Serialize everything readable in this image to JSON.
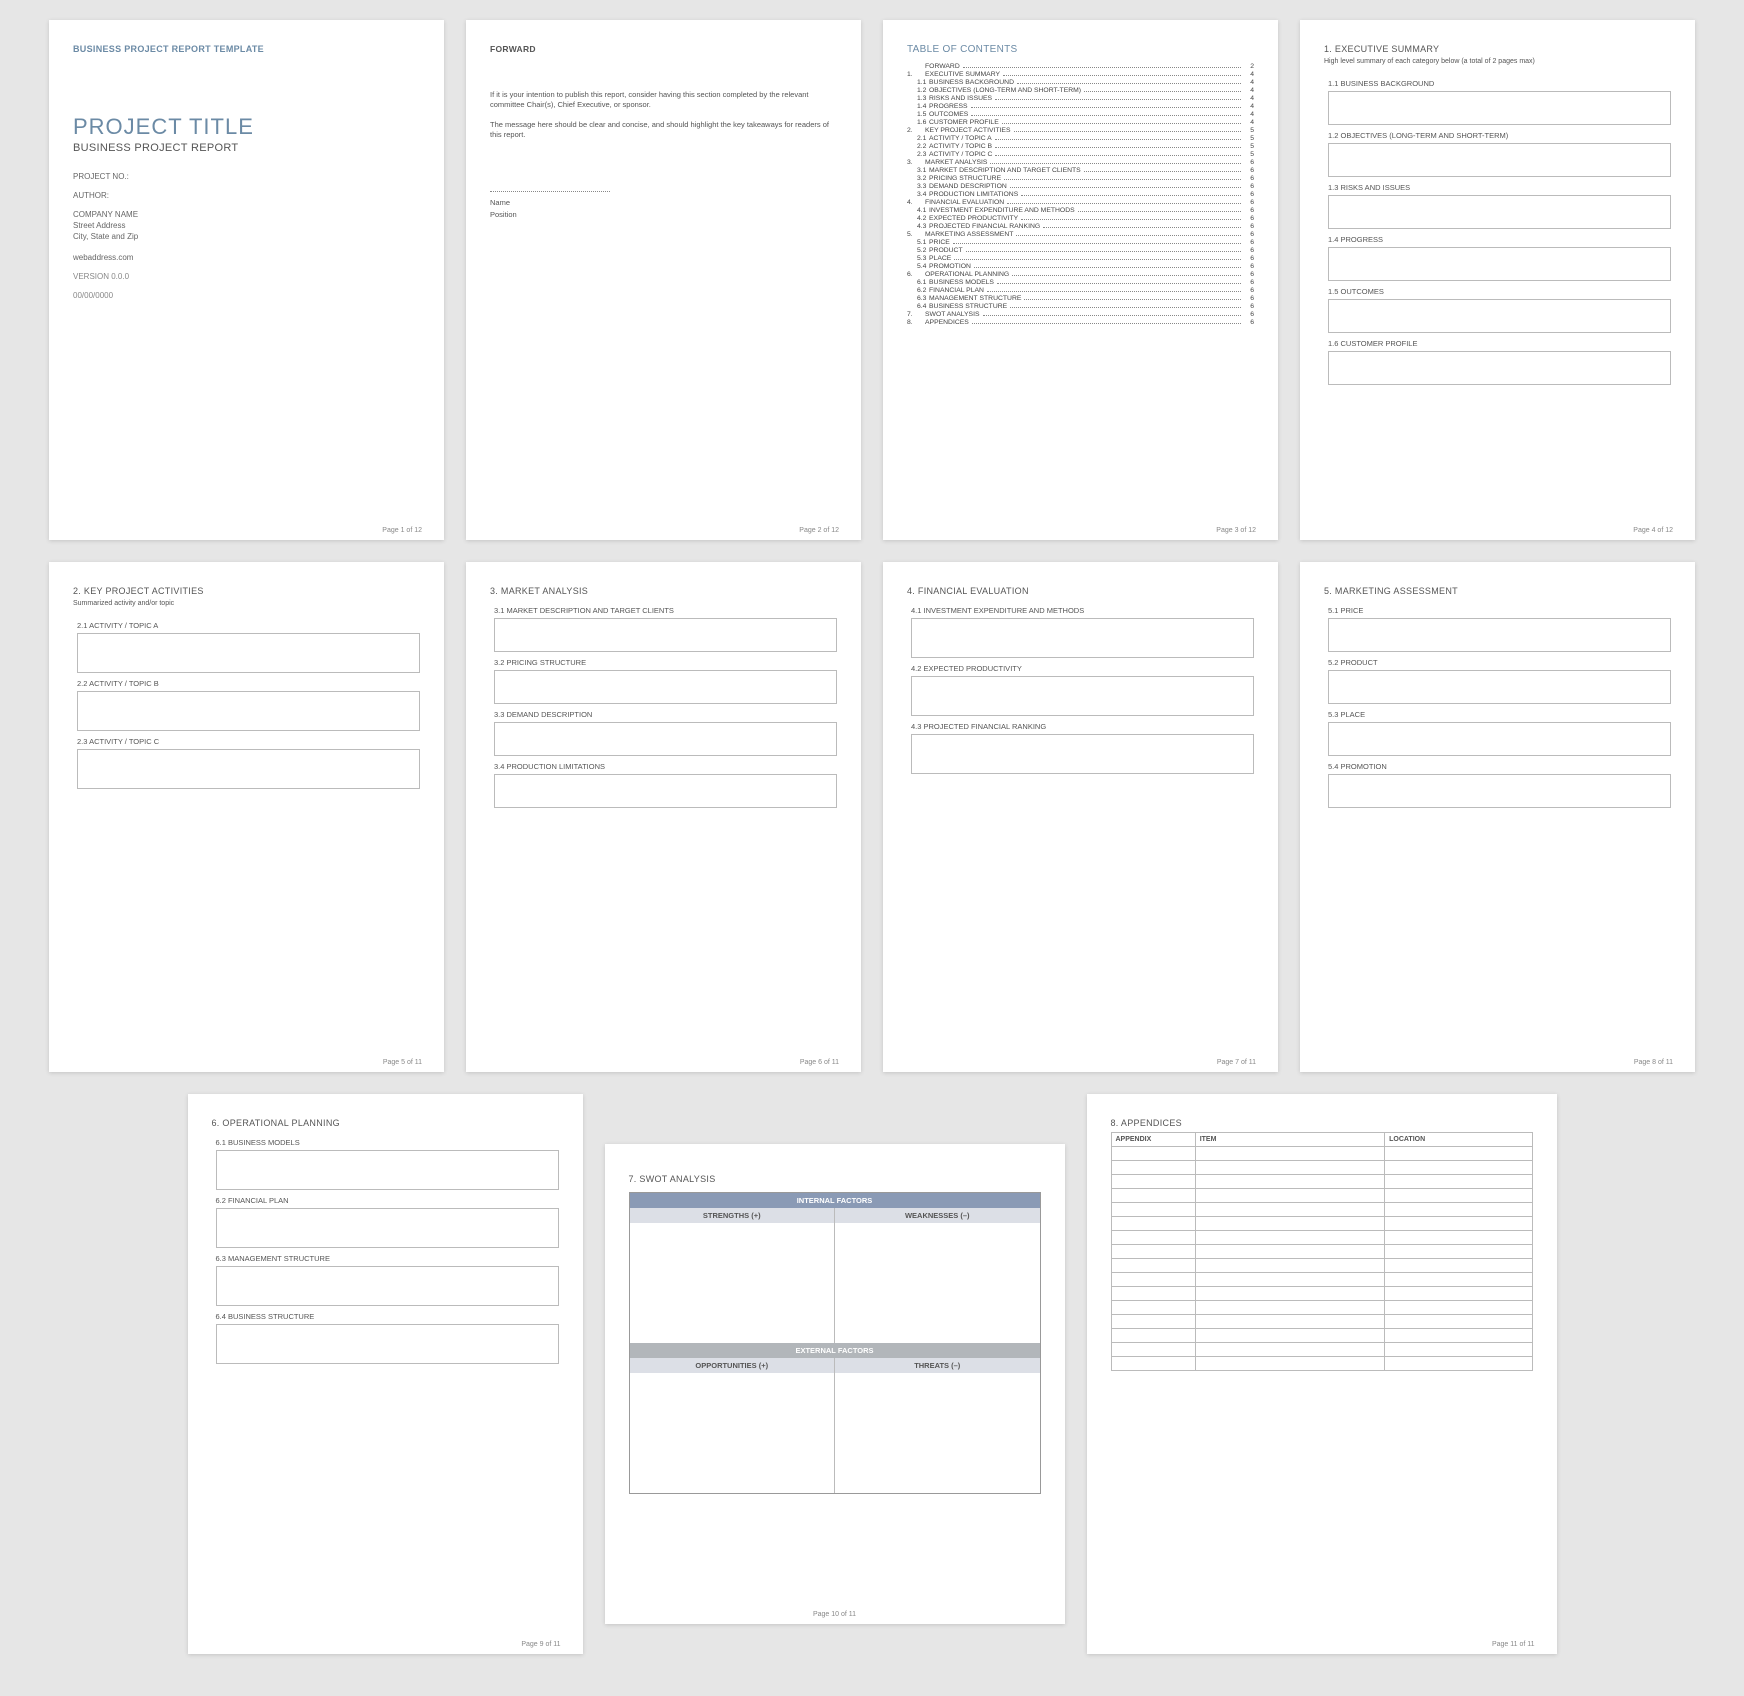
{
  "doc_header": "BUSINESS PROJECT REPORT TEMPLATE",
  "cover": {
    "title": "PROJECT TITLE",
    "subtitle": "BUSINESS PROJECT REPORT",
    "project_no_label": "PROJECT NO.:",
    "author_label": "AUTHOR:",
    "company": "COMPANY NAME",
    "street": "Street Address",
    "city": "City, State and Zip",
    "web": "webaddress.com",
    "version": "VERSION 0.0.0",
    "date": "00/00/0000"
  },
  "forward": {
    "heading": "FORWARD",
    "p1": "If it is your intention to publish this report, consider having this section completed by the relevant committee Chair(s), Chief Executive, or sponsor.",
    "p2": "The message here should be clear and concise, and should highlight the key takeaways for readers of this report.",
    "name_label": "Name",
    "position_label": "Position"
  },
  "toc": {
    "heading": "TABLE OF CONTENTS",
    "rows": [
      {
        "n": "",
        "l": "FORWARD",
        "p": "2"
      },
      {
        "n": "1.",
        "l": "EXECUTIVE SUMMARY",
        "p": "4"
      },
      {
        "n": "1.1",
        "l": "BUSINESS BACKGROUND",
        "p": "4",
        "sub": true
      },
      {
        "n": "1.2",
        "l": "OBJECTIVES (LONG-TERM AND SHORT-TERM)",
        "p": "4",
        "sub": true
      },
      {
        "n": "1.3",
        "l": "RISKS AND ISSUES",
        "p": "4",
        "sub": true
      },
      {
        "n": "1.4",
        "l": "PROGRESS",
        "p": "4",
        "sub": true
      },
      {
        "n": "1.5",
        "l": "OUTCOMES",
        "p": "4",
        "sub": true
      },
      {
        "n": "1.6",
        "l": "CUSTOMER PROFILE",
        "p": "4",
        "sub": true
      },
      {
        "n": "2.",
        "l": "KEY PROJECT ACTIVITIES",
        "p": "5"
      },
      {
        "n": "2.1",
        "l": "ACTIVITY / TOPIC A",
        "p": "5",
        "sub": true
      },
      {
        "n": "2.2",
        "l": "ACTIVITY / TOPIC B",
        "p": "5",
        "sub": true
      },
      {
        "n": "2.3",
        "l": "ACTIVITY / TOPIC C",
        "p": "5",
        "sub": true
      },
      {
        "n": "3.",
        "l": "MARKET ANALYSIS",
        "p": "6"
      },
      {
        "n": "3.1",
        "l": "MARKET DESCRIPTION AND TARGET CLIENTS",
        "p": "6",
        "sub": true
      },
      {
        "n": "3.2",
        "l": "PRICING STRUCTURE",
        "p": "6",
        "sub": true
      },
      {
        "n": "3.3",
        "l": "DEMAND DESCRIPTION",
        "p": "6",
        "sub": true
      },
      {
        "n": "3.4",
        "l": "PRODUCTION LIMITATIONS",
        "p": "6",
        "sub": true
      },
      {
        "n": "4.",
        "l": "FINANCIAL EVALUATION",
        "p": "6"
      },
      {
        "n": "4.1",
        "l": "INVESTMENT EXPENDITURE AND METHODS",
        "p": "6",
        "sub": true
      },
      {
        "n": "4.2",
        "l": "EXPECTED PRODUCTIVITY",
        "p": "6",
        "sub": true
      },
      {
        "n": "4.3",
        "l": "PROJECTED FINANCIAL RANKING",
        "p": "6",
        "sub": true
      },
      {
        "n": "5.",
        "l": "MARKETING ASSESSMENT",
        "p": "6"
      },
      {
        "n": "5.1",
        "l": "PRICE",
        "p": "6",
        "sub": true
      },
      {
        "n": "5.2",
        "l": "PRODUCT",
        "p": "6",
        "sub": true
      },
      {
        "n": "5.3",
        "l": "PLACE",
        "p": "6",
        "sub": true
      },
      {
        "n": "5.4",
        "l": "PROMOTION",
        "p": "6",
        "sub": true
      },
      {
        "n": "6.",
        "l": "OPERATIONAL PLANNING",
        "p": "6"
      },
      {
        "n": "6.1",
        "l": "BUSINESS MODELS",
        "p": "6",
        "sub": true
      },
      {
        "n": "6.2",
        "l": "FINANCIAL PLAN",
        "p": "6",
        "sub": true
      },
      {
        "n": "6.3",
        "l": "MANAGEMENT STRUCTURE",
        "p": "6",
        "sub": true
      },
      {
        "n": "6.4",
        "l": "BUSINESS STRUCTURE",
        "p": "6",
        "sub": true
      },
      {
        "n": "7.",
        "l": "SWOT ANALYSIS",
        "p": "6"
      },
      {
        "n": "8.",
        "l": "APPENDICES",
        "p": "6"
      }
    ]
  },
  "exec": {
    "heading": "1. EXECUTIVE SUMMARY",
    "note": "High level summary of each category below (a total of 2 pages max)",
    "subs": [
      "1.1  BUSINESS BACKGROUND",
      "1.2  OBJECTIVES (LONG-TERM AND SHORT-TERM)",
      "1.3  RISKS AND ISSUES",
      "1.4  PROGRESS",
      "1.5  OUTCOMES",
      "1.6  CUSTOMER PROFILE"
    ]
  },
  "key": {
    "heading": "2. KEY PROJECT ACTIVITIES",
    "note": "Summarized activity and/or topic",
    "subs": [
      "2.1  ACTIVITY / TOPIC A",
      "2.2  ACTIVITY / TOPIC B",
      "2.3  ACTIVITY / TOPIC C"
    ]
  },
  "market": {
    "heading": "3. MARKET ANALYSIS",
    "subs": [
      "3.1  MARKET DESCRIPTION AND TARGET CLIENTS",
      "3.2  PRICING STRUCTURE",
      "3.3  DEMAND DESCRIPTION",
      "3.4  PRODUCTION LIMITATIONS"
    ]
  },
  "fin": {
    "heading": "4. FINANCIAL EVALUATION",
    "subs": [
      "4.1  INVESTMENT EXPENDITURE AND METHODS",
      "4.2  EXPECTED PRODUCTIVITY",
      "4.3  PROJECTED FINANCIAL RANKING"
    ]
  },
  "mkt": {
    "heading": "5. MARKETING ASSESSMENT",
    "subs": [
      "5.1  PRICE",
      "5.2  PRODUCT",
      "5.3  PLACE",
      "5.4  PROMOTION"
    ]
  },
  "op": {
    "heading": "6. OPERATIONAL PLANNING",
    "subs": [
      "6.1  BUSINESS MODELS",
      "6.2  FINANCIAL PLAN",
      "6.3  MANAGEMENT STRUCTURE",
      "6.4  BUSINESS STRUCTURE"
    ]
  },
  "swot": {
    "heading": "7. SWOT ANALYSIS",
    "internal": "INTERNAL FACTORS",
    "external": "EXTERNAL FACTORS",
    "strengths": "STRENGTHS (+)",
    "weaknesses": "WEAKNESSES (–)",
    "opportunities": "OPPORTUNITIES (+)",
    "threats": "THREATS (–)"
  },
  "apx": {
    "heading": "8. APPENDICES",
    "cols": [
      "APPENDIX",
      "ITEM",
      "LOCATION"
    ],
    "rows": 16
  },
  "footers": {
    "p1": "Page 1 of 12",
    "p2": "Page 2 of 12",
    "p3": "Page 3 of 12",
    "p4": "Page 4 of 12",
    "p5": "Page 5 of 11",
    "p6": "Page 6 of 11",
    "p7": "Page 7 of 11",
    "p8": "Page 8 of 11",
    "p9": "Page 9 of 11",
    "p10": "Page 10 of 11",
    "p11": "Page 11 of 11"
  }
}
